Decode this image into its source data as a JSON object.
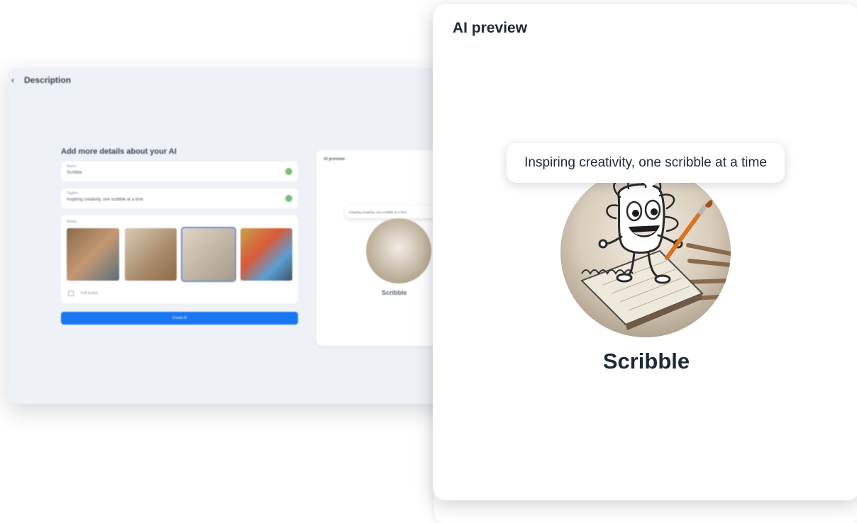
{
  "background_window": {
    "header_title": "Description",
    "form_title": "Add more details about your AI",
    "name_label": "Name",
    "name_value": "Scribble",
    "tagline_label": "Tagline",
    "tagline_value": "Inspiring creativity, one scribble at a time",
    "avatar_label": "Avatar",
    "edit_avatar_label": "Edit Avatar",
    "create_button": "Create AI",
    "preview_title": "AI preview",
    "preview_tooltip": "Inspiring creativity, one scribble at a time",
    "preview_name": "Scribble"
  },
  "preview_card": {
    "title": "AI preview",
    "tooltip_text": "Inspiring creativity, one scribble at a time",
    "name": "Scribble"
  },
  "colors": {
    "primary_button": "#1877f2",
    "text_dark": "#1c2b33",
    "check_green": "#7cbf7a"
  }
}
